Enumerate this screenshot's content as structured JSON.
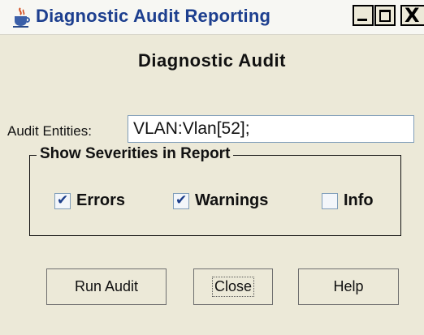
{
  "window": {
    "title": "Diagnostic Audit Reporting",
    "controls": {
      "minimize": "_",
      "maximize": "□",
      "close": "X"
    }
  },
  "heading": "Diagnostic Audit",
  "entities": {
    "label": "Audit Entities:",
    "value": "VLAN:Vlan[52];"
  },
  "severities": {
    "legend": "Show Severities in Report",
    "options": [
      {
        "label": "Errors",
        "checked": true
      },
      {
        "label": "Warnings",
        "checked": true
      },
      {
        "label": "Info",
        "checked": false
      }
    ]
  },
  "buttons": {
    "run": "Run Audit",
    "close": "Close",
    "help": "Help"
  },
  "icons": {
    "app": "java-cup-icon",
    "minimize": "minimize-icon",
    "maximize": "maximize-icon",
    "close": "close-icon",
    "check": "checkmark-icon"
  }
}
